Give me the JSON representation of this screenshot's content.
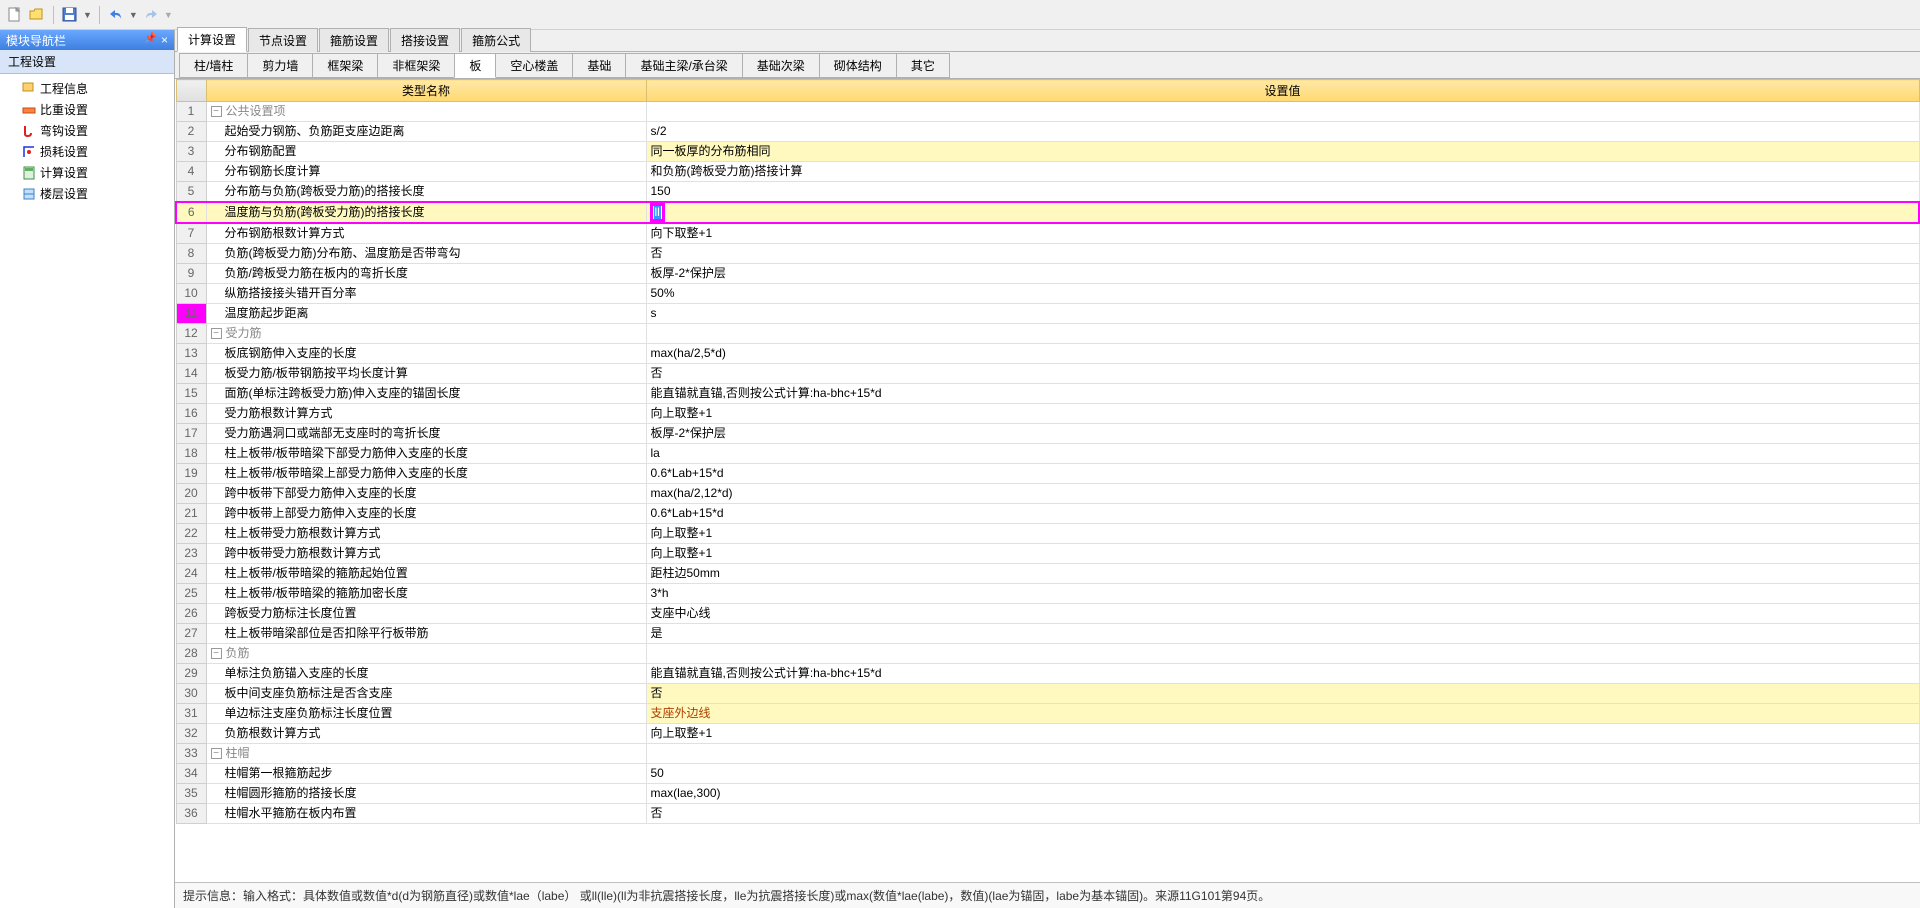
{
  "toolbar": {
    "new_tip": "新建",
    "open_tip": "打开",
    "save_tip": "保存",
    "undo_tip": "撤销",
    "redo_tip": "恢复"
  },
  "nav": {
    "title": "模块导航栏",
    "sub": "工程设置",
    "items": [
      {
        "icon": "wrench",
        "label": "工程信息"
      },
      {
        "icon": "ruler",
        "label": "比重设置"
      },
      {
        "icon": "hook",
        "label": "弯钩设置"
      },
      {
        "icon": "loss",
        "label": "损耗设置"
      },
      {
        "icon": "calc",
        "label": "计算设置"
      },
      {
        "icon": "floor",
        "label": "楼层设置"
      }
    ]
  },
  "tabs1": [
    {
      "label": "计算设置",
      "active": true
    },
    {
      "label": "节点设置",
      "active": false
    },
    {
      "label": "箍筋设置",
      "active": false
    },
    {
      "label": "搭接设置",
      "active": false
    },
    {
      "label": "箍筋公式",
      "active": false
    }
  ],
  "tabs2": [
    {
      "label": "柱/墙柱",
      "active": false
    },
    {
      "label": "剪力墙",
      "active": false
    },
    {
      "label": "框架梁",
      "active": false
    },
    {
      "label": "非框架梁",
      "active": false
    },
    {
      "label": "板",
      "active": true
    },
    {
      "label": "空心楼盖",
      "active": false
    },
    {
      "label": "基础",
      "active": false
    },
    {
      "label": "基础主梁/承台梁",
      "active": false
    },
    {
      "label": "基础次梁",
      "active": false
    },
    {
      "label": "砌体结构",
      "active": false
    },
    {
      "label": "其它",
      "active": false
    }
  ],
  "grid": {
    "h_num": "",
    "h_name": "类型名称",
    "h_val": "设置值"
  },
  "rows": [
    {
      "n": 1,
      "type": "hdr",
      "name": "公共设置项",
      "val": ""
    },
    {
      "n": 2,
      "type": "r",
      "name": "起始受力钢筋、负筋距支座边距离",
      "val": "s/2"
    },
    {
      "n": 3,
      "type": "r",
      "hl": 1,
      "name": "分布钢筋配置",
      "val": "同一板厚的分布筋相同"
    },
    {
      "n": 4,
      "type": "r",
      "name": "分布钢筋长度计算",
      "val": "和负筋(跨板受力筋)搭接计算"
    },
    {
      "n": 5,
      "type": "r",
      "name": "分布筋与负筋(跨板受力筋)的搭接长度",
      "val": "150"
    },
    {
      "n": 6,
      "type": "edit",
      "name": "温度筋与负筋(跨板受力筋)的搭接长度",
      "val": "ll"
    },
    {
      "n": 7,
      "type": "r",
      "name": "分布钢筋根数计算方式",
      "val": "向下取整+1"
    },
    {
      "n": 8,
      "type": "r",
      "name": "负筋(跨板受力筋)分布筋、温度筋是否带弯勾",
      "val": "否"
    },
    {
      "n": 9,
      "type": "r",
      "name": "负筋/跨板受力筋在板内的弯折长度",
      "val": "板厚-2*保护层"
    },
    {
      "n": 10,
      "type": "r",
      "name": "纵筋搭接接头错开百分率",
      "val": "50%"
    },
    {
      "n": 11,
      "type": "r",
      "mark": 1,
      "name": "温度筋起步距离",
      "val": "s"
    },
    {
      "n": 12,
      "type": "hdr",
      "name": "受力筋",
      "val": ""
    },
    {
      "n": 13,
      "type": "r",
      "name": "板底钢筋伸入支座的长度",
      "val": "max(ha/2,5*d)"
    },
    {
      "n": 14,
      "type": "r",
      "name": "板受力筋/板带钢筋按平均长度计算",
      "val": "否"
    },
    {
      "n": 15,
      "type": "r",
      "name": "面筋(单标注跨板受力筋)伸入支座的锚固长度",
      "val": "能直锚就直锚,否则按公式计算:ha-bhc+15*d"
    },
    {
      "n": 16,
      "type": "r",
      "name": "受力筋根数计算方式",
      "val": "向上取整+1"
    },
    {
      "n": 17,
      "type": "r",
      "name": "受力筋遇洞口或端部无支座时的弯折长度",
      "val": "板厚-2*保护层"
    },
    {
      "n": 18,
      "type": "r",
      "name": "柱上板带/板带暗梁下部受力筋伸入支座的长度",
      "val": "la"
    },
    {
      "n": 19,
      "type": "r",
      "name": "柱上板带/板带暗梁上部受力筋伸入支座的长度",
      "val": "0.6*Lab+15*d"
    },
    {
      "n": 20,
      "type": "r",
      "name": "跨中板带下部受力筋伸入支座的长度",
      "val": "max(ha/2,12*d)"
    },
    {
      "n": 21,
      "type": "r",
      "name": "跨中板带上部受力筋伸入支座的长度",
      "val": "0.6*Lab+15*d"
    },
    {
      "n": 22,
      "type": "r",
      "name": "柱上板带受力筋根数计算方式",
      "val": "向上取整+1"
    },
    {
      "n": 23,
      "type": "r",
      "name": "跨中板带受力筋根数计算方式",
      "val": "向上取整+1"
    },
    {
      "n": 24,
      "type": "r",
      "name": "柱上板带/板带暗梁的箍筋起始位置",
      "val": "距柱边50mm"
    },
    {
      "n": 25,
      "type": "r",
      "name": "柱上板带/板带暗梁的箍筋加密长度",
      "val": "3*h"
    },
    {
      "n": 26,
      "type": "r",
      "name": "跨板受力筋标注长度位置",
      "val": "支座中心线"
    },
    {
      "n": 27,
      "type": "r",
      "name": "柱上板带暗梁部位是否扣除平行板带筋",
      "val": "是"
    },
    {
      "n": 28,
      "type": "hdr",
      "name": "负筋",
      "val": ""
    },
    {
      "n": 29,
      "type": "r",
      "name": "单标注负筋锚入支座的长度",
      "val": "能直锚就直锚,否则按公式计算:ha-bhc+15*d"
    },
    {
      "n": 30,
      "type": "r",
      "hl": 1,
      "name": "板中间支座负筋标注是否含支座",
      "val": "否"
    },
    {
      "n": 31,
      "type": "r",
      "hlr": 1,
      "name": "单边标注支座负筋标注长度位置",
      "val": "支座外边线"
    },
    {
      "n": 32,
      "type": "r",
      "name": "负筋根数计算方式",
      "val": "向上取整+1"
    },
    {
      "n": 33,
      "type": "hdr",
      "name": "柱帽",
      "val": ""
    },
    {
      "n": 34,
      "type": "r",
      "name": "柱帽第一根箍筋起步",
      "val": "50"
    },
    {
      "n": 35,
      "type": "r",
      "name": "柱帽圆形箍筋的搭接长度",
      "val": "max(lae,300)"
    },
    {
      "n": 36,
      "type": "r",
      "name": "柱帽水平箍筋在板内布置",
      "val": "否"
    }
  ],
  "footer": "提示信息：输入格式：具体数值或数值*d(d为钢筋直径)或数值*lae（labe） 或ll(lle)(ll为非抗震搭接长度，lle为抗震搭接长度)或max(数值*lae(labe)，数值)(lae为锚固，labe为基本锚固)。来源11G101第94页。"
}
